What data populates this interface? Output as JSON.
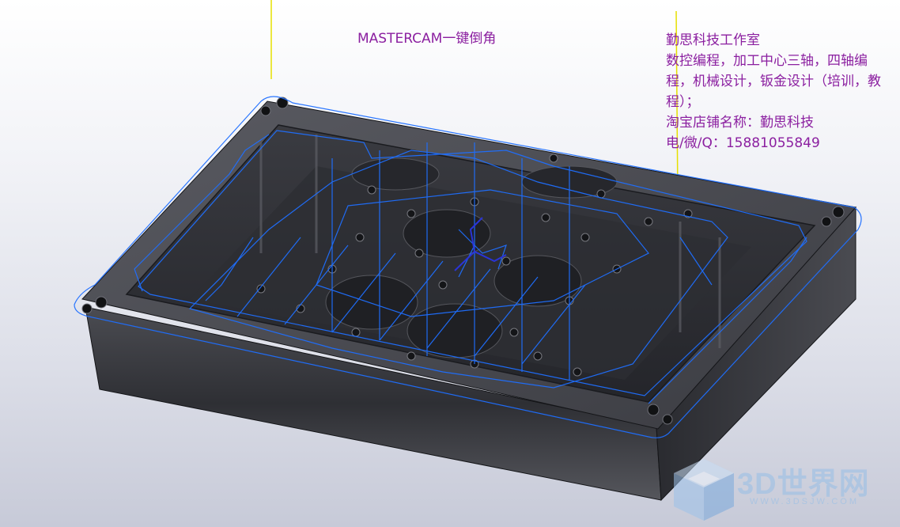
{
  "colors": {
    "background_top": "#ffffff",
    "background_bottom": "#c7cad8",
    "part_body": "#3a3b40",
    "part_dark": "#1c1d21",
    "part_light": "#6c6e76",
    "toolpath": "#1f6fff",
    "axis_line": "#e6e000",
    "caption": "#8b1fa0",
    "watermark": "#a9c8ec"
  },
  "viewport": {
    "model": "machined pocket plate with drilled holes and toolpath overlay",
    "icons": [
      "tool-axis-line-icon",
      "part-model-icon",
      "cube-logo-icon"
    ]
  },
  "caption_title": "MASTERCAM一键倒角",
  "studio": {
    "lines": [
      "勤思科技工作室",
      "数控编程，加工中心三轴，四轴编程，机械设计，钣金设计（培训，教程）；",
      "淘宝店铺名称：勤思科技",
      "电/微/Q：15881055849"
    ]
  },
  "watermark": {
    "text": "3D世界网",
    "url": "WWW.3DSJW.COM"
  }
}
